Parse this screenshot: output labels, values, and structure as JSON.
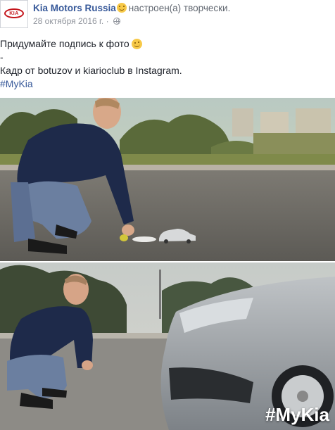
{
  "header": {
    "page_name": "Kia Motors Russia",
    "feeling": "настроен(а) творчески.",
    "date": "28 октября 2016 г. ·",
    "avatar_logo_text": "KIA",
    "feeling_icon": "smile-emoji-icon",
    "privacy_icon": "globe-icon"
  },
  "post": {
    "line1": "Придумайте подпись к фото",
    "line1_emoji": "wink-emoji-icon",
    "line2": "-",
    "line3": "Кадр от botuzov и kiarioclub в Instagram.",
    "hashtag": "#MyKia"
  },
  "photos": {
    "top": {
      "description_icon": "photo-man-with-toy-car"
    },
    "bottom": {
      "watermark": "#MyKia"
    }
  },
  "colors": {
    "link": "#365899",
    "meta": "#90949c",
    "brand_red": "#c4161c"
  }
}
